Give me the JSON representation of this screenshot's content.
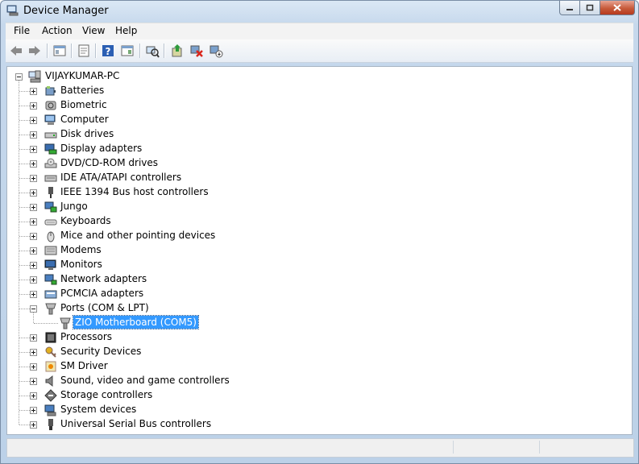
{
  "window": {
    "title": "Device Manager"
  },
  "menu": [
    "File",
    "Action",
    "View",
    "Help"
  ],
  "toolbar_icons": [
    "back-arrow-icon",
    "forward-arrow-icon",
    "show-hide-tree-icon",
    "properties-icon",
    "help-icon",
    "show-hide-action-pane-icon",
    "scan-hardware-changes-icon",
    "update-driver-icon",
    "uninstall-device-icon",
    "disable-device-icon"
  ],
  "tree": {
    "root": "VIJAYKUMAR-PC",
    "categories": [
      {
        "label": "Batteries",
        "icon": "battery-icon",
        "expanded": false
      },
      {
        "label": "Biometric",
        "icon": "biometric-icon",
        "expanded": false
      },
      {
        "label": "Computer",
        "icon": "computer-icon",
        "expanded": false
      },
      {
        "label": "Disk drives",
        "icon": "disk-drive-icon",
        "expanded": false
      },
      {
        "label": "Display adapters",
        "icon": "display-adapter-icon",
        "expanded": false
      },
      {
        "label": "DVD/CD-ROM drives",
        "icon": "dvd-drive-icon",
        "expanded": false
      },
      {
        "label": "IDE ATA/ATAPI controllers",
        "icon": "ide-controller-icon",
        "expanded": false
      },
      {
        "label": "IEEE 1394 Bus host controllers",
        "icon": "ieee1394-icon",
        "expanded": false
      },
      {
        "label": "Jungo",
        "icon": "jungo-icon",
        "expanded": false
      },
      {
        "label": "Keyboards",
        "icon": "keyboard-icon",
        "expanded": false
      },
      {
        "label": "Mice and other pointing devices",
        "icon": "mouse-icon",
        "expanded": false
      },
      {
        "label": "Modems",
        "icon": "modem-icon",
        "expanded": false
      },
      {
        "label": "Monitors",
        "icon": "monitor-icon",
        "expanded": false
      },
      {
        "label": "Network adapters",
        "icon": "network-adapter-icon",
        "expanded": false
      },
      {
        "label": "PCMCIA adapters",
        "icon": "pcmcia-icon",
        "expanded": false
      },
      {
        "label": "Ports (COM & LPT)",
        "icon": "port-icon",
        "expanded": true,
        "children": [
          "ZIO Motherboard (COM5)"
        ]
      },
      {
        "label": "Processors",
        "icon": "processor-icon",
        "expanded": false
      },
      {
        "label": "Security Devices",
        "icon": "security-key-icon",
        "expanded": false
      },
      {
        "label": "SM Driver",
        "icon": "sm-driver-icon",
        "expanded": false
      },
      {
        "label": "Sound, video and game controllers",
        "icon": "speaker-icon",
        "expanded": false
      },
      {
        "label": "Storage controllers",
        "icon": "storage-controller-icon",
        "expanded": false
      },
      {
        "label": "System devices",
        "icon": "system-device-icon",
        "expanded": false
      },
      {
        "label": "Universal Serial Bus controllers",
        "icon": "usb-icon",
        "expanded": false
      }
    ],
    "selected": "ZIO Motherboard (COM5)"
  },
  "colors": {
    "selection": "#3399ff",
    "tree_line": "#a0a0a0"
  }
}
